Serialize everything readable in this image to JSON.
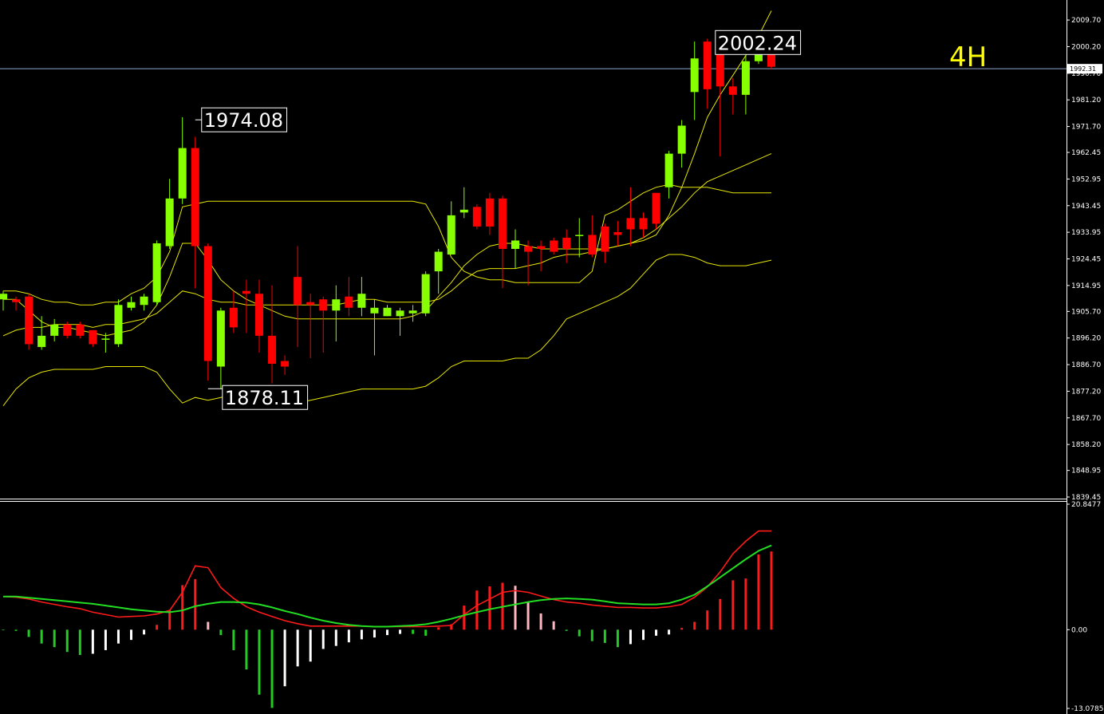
{
  "timeframe_label": "4H",
  "current_price_label": "1992.31",
  "colors": {
    "background": "#000000",
    "bull": "#88ff00",
    "bear": "#ff0000",
    "band": "#e6e600",
    "macd_fast": "#ff1a1a",
    "macd_slow": "#22dd22",
    "hist_up_strong": "#ff1a1a",
    "hist_up_weak": "#ffb6c1",
    "hist_down_strong": "#22cc22",
    "hist_down_weak": "#ffffff",
    "current_line": "#8ea8c8",
    "axis": "#ffffff"
  },
  "chart_data": [
    {
      "type": "candlestick",
      "title": "",
      "ylim": [
        1839.45,
        2014.0
      ],
      "y_ticks": [
        "2009.70",
        "2000.20",
        "1990.70",
        "1981.20",
        "1971.70",
        "1962.45",
        "1952.95",
        "1943.45",
        "1933.95",
        "1924.45",
        "1914.95",
        "1905.70",
        "1896.20",
        "1886.70",
        "1877.20",
        "1867.70",
        "1858.20",
        "1848.95",
        "1839.45"
      ],
      "current_price": 1992.31,
      "annotations": [
        {
          "label": "1974.08",
          "bar": 15,
          "value": 1974.08
        },
        {
          "label": "1878.11",
          "bar": 16,
          "value": 1878.11
        },
        {
          "label": "2002.24",
          "bar": 56,
          "value": 2002.24
        }
      ],
      "candles": [
        [
          1910,
          1912,
          1906,
          1913
        ],
        [
          1910,
          1909,
          1906,
          1911
        ],
        [
          1911,
          1894,
          1892,
          1912
        ],
        [
          1893,
          1897,
          1892,
          1904
        ],
        [
          1897,
          1901,
          1895,
          1903
        ],
        [
          1901,
          1897,
          1896,
          1902
        ],
        [
          1901,
          1897,
          1896,
          1902
        ],
        [
          1899,
          1894,
          1893,
          1899
        ],
        [
          1896,
          1896,
          1891,
          1898
        ],
        [
          1894,
          1908,
          1893,
          1910
        ],
        [
          1907,
          1909,
          1906,
          1911
        ],
        [
          1908,
          1911,
          1906,
          1912
        ],
        [
          1909,
          1930,
          1908,
          1931
        ],
        [
          1929,
          1946,
          1928,
          1953
        ],
        [
          1946,
          1964,
          1944,
          1975
        ],
        [
          1964,
          1929,
          1914,
          1968
        ],
        [
          1929,
          1888,
          1881,
          1930
        ],
        [
          1886,
          1906,
          1878,
          1907
        ],
        [
          1907,
          1900,
          1898,
          1913
        ],
        [
          1913,
          1912,
          1898,
          1917
        ],
        [
          1912,
          1897,
          1891,
          1917
        ],
        [
          1897,
          1887,
          1880,
          1915
        ],
        [
          1888,
          1886,
          1883,
          1890
        ],
        [
          1918,
          1908,
          1893,
          1929
        ],
        [
          1909,
          1908,
          1889,
          1912
        ],
        [
          1910,
          1906,
          1891,
          1911
        ],
        [
          1906,
          1910,
          1895,
          1915
        ],
        [
          1911,
          1907,
          1904,
          1918
        ],
        [
          1907,
          1912,
          1904,
          1918
        ],
        [
          1905,
          1907,
          1890,
          1910
        ],
        [
          1904,
          1907,
          1904,
          1908
        ],
        [
          1904,
          1906,
          1897,
          1907
        ],
        [
          1905,
          1906,
          1902,
          1908
        ],
        [
          1905,
          1919,
          1904,
          1920
        ],
        [
          1920,
          1927,
          1912,
          1928
        ],
        [
          1926,
          1940,
          1926,
          1945
        ],
        [
          1941,
          1942,
          1939,
          1950
        ],
        [
          1943,
          1936,
          1935,
          1944
        ],
        [
          1946,
          1936,
          1933,
          1948
        ],
        [
          1946,
          1928,
          1914,
          1947
        ],
        [
          1928,
          1931,
          1921,
          1935
        ],
        [
          1929,
          1927,
          1915,
          1931
        ],
        [
          1929,
          1928,
          1920,
          1931
        ],
        [
          1931,
          1927,
          1926,
          1932
        ],
        [
          1932,
          1928,
          1923,
          1935
        ],
        [
          1933,
          1933,
          1925,
          1939
        ],
        [
          1933,
          1926,
          1925,
          1940
        ],
        [
          1936,
          1927,
          1923,
          1937
        ],
        [
          1934,
          1933,
          1929,
          1938
        ],
        [
          1939,
          1935,
          1929,
          1950
        ],
        [
          1939,
          1935,
          1932,
          1941
        ],
        [
          1948,
          1937,
          1935,
          1948
        ],
        [
          1950,
          1962,
          1946,
          1963
        ],
        [
          1962,
          1972,
          1957,
          1974
        ],
        [
          1984,
          1996,
          1974,
          2002
        ],
        [
          2002,
          1985,
          1978,
          2003
        ],
        [
          2002,
          1986,
          1961,
          2002
        ],
        [
          1986,
          1983,
          1976,
          1989
        ],
        [
          1983,
          1995,
          1976,
          1998
        ],
        [
          1995,
          1999,
          1994,
          2000
        ],
        [
          1999,
          1993,
          1992,
          2000
        ]
      ],
      "bollinger": {
        "upper": [
          1913,
          1913,
          1912,
          1910,
          1909,
          1909,
          1908,
          1908,
          1909,
          1909,
          1912,
          1914,
          1918,
          1927,
          1943,
          1944,
          1945,
          1945,
          1945,
          1945,
          1945,
          1945,
          1945,
          1945,
          1945,
          1945,
          1945,
          1945,
          1945,
          1945,
          1945,
          1945,
          1945,
          1944,
          1936,
          1925,
          1920,
          1918,
          1917,
          1917,
          1916,
          1916,
          1916,
          1916,
          1916,
          1916,
          1920,
          1940,
          1942,
          1945,
          1948,
          1950,
          1951,
          1950,
          1950,
          1950,
          1949,
          1948,
          1948,
          1948,
          1948
        ],
        "middle": [
          1897,
          1899,
          1900,
          1900,
          1901,
          1901,
          1901,
          1900,
          1901,
          1901,
          1902,
          1903,
          1905,
          1909,
          1913,
          1912,
          1910,
          1909,
          1909,
          1908,
          1908,
          1908,
          1908,
          1908,
          1908,
          1908,
          1908,
          1909,
          1910,
          1910,
          1909,
          1909,
          1909,
          1909,
          1910,
          1913,
          1917,
          1920,
          1921,
          1921,
          1921,
          1922,
          1923,
          1925,
          1926,
          1926,
          1927,
          1928,
          1929,
          1930,
          1932,
          1935,
          1939,
          1943,
          1948,
          1952,
          1954,
          1956,
          1958,
          1960,
          1962
        ],
        "lower": [
          1872,
          1878,
          1882,
          1884,
          1885,
          1885,
          1885,
          1885,
          1886,
          1886,
          1886,
          1886,
          1884,
          1878,
          1873,
          1875,
          1874,
          1875,
          1876,
          1876,
          1875,
          1874,
          1873,
          1873,
          1874,
          1875,
          1876,
          1877,
          1878,
          1878,
          1878,
          1878,
          1878,
          1879,
          1882,
          1886,
          1888,
          1888,
          1888,
          1888,
          1889,
          1889,
          1892,
          1897,
          1903,
          1905,
          1907,
          1909,
          1911,
          1914,
          1919,
          1924,
          1926,
          1926,
          1925,
          1923,
          1922,
          1922,
          1922,
          1923,
          1924
        ]
      },
      "line": [
        1910,
        1910,
        1906,
        1902,
        1900,
        1900,
        1899,
        1898,
        1897,
        1898,
        1899,
        1902,
        1908,
        1918,
        1930,
        1930,
        1924,
        1917,
        1913,
        1910,
        1908,
        1906,
        1904,
        1903,
        1903,
        1903,
        1903,
        1903,
        1903,
        1903,
        1903,
        1903,
        1904,
        1906,
        1911,
        1916,
        1922,
        1926,
        1929,
        1930,
        1930,
        1929,
        1928,
        1928,
        1928,
        1928,
        1928,
        1928,
        1929,
        1930,
        1931,
        1933,
        1940,
        1950,
        1962,
        1975,
        1983,
        1990,
        1997,
        2004,
        2013
      ]
    },
    {
      "type": "macd",
      "ylim": [
        -13.0785,
        20.8477
      ],
      "y_ticks": [
        "20.8477",
        "0.00",
        "-13.0785"
      ],
      "fast_line": [
        5.5,
        5.4,
        5.1,
        4.6,
        4.2,
        3.8,
        3.5,
        2.9,
        2.5,
        2.1,
        2.2,
        2.3,
        2.6,
        3.2,
        6.2,
        10.6,
        10.3,
        7.0,
        5.2,
        3.8,
        2.9,
        2.2,
        1.5,
        1.0,
        0.6,
        0.6,
        0.6,
        0.6,
        0.6,
        0.5,
        0.5,
        0.5,
        0.5,
        0.5,
        0.6,
        0.7,
        2.5,
        4.0,
        5.1,
        6.2,
        6.5,
        6.2,
        5.6,
        5.0,
        4.6,
        4.4,
        4.1,
        3.9,
        3.7,
        3.7,
        3.6,
        3.6,
        3.8,
        4.2,
        5.4,
        7.1,
        9.6,
        12.6,
        14.7,
        16.4,
        16.4
      ],
      "slow_line": [
        5.5,
        5.5,
        5.3,
        5.1,
        4.9,
        4.7,
        4.5,
        4.3,
        4.0,
        3.7,
        3.4,
        3.2,
        3.0,
        2.9,
        3.2,
        3.9,
        4.3,
        4.6,
        4.6,
        4.5,
        4.2,
        3.7,
        3.1,
        2.6,
        2.0,
        1.5,
        1.1,
        0.8,
        0.6,
        0.5,
        0.5,
        0.6,
        0.7,
        0.9,
        1.3,
        1.8,
        2.4,
        2.9,
        3.4,
        3.8,
        4.2,
        4.6,
        4.9,
        5.1,
        5.2,
        5.1,
        5.0,
        4.7,
        4.4,
        4.3,
        4.2,
        4.2,
        4.4,
        5.0,
        5.8,
        7.2,
        8.7,
        10.2,
        11.7,
        13.1,
        14.0
      ],
      "histogram": [
        -0.1,
        -0.2,
        -1.2,
        -2.3,
        -2.9,
        -3.7,
        -4.2,
        -4.0,
        -3.4,
        -2.3,
        -1.7,
        -0.8,
        0.8,
        3.3,
        7.4,
        8.4,
        1.3,
        -0.9,
        -3.4,
        -6.6,
        -10.8,
        -13.0,
        -9.4,
        -6.1,
        -5.3,
        -3.2,
        -2.7,
        -2.1,
        -1.6,
        -1.3,
        -0.9,
        -0.7,
        -0.7,
        -1.0,
        0.4,
        0.9,
        4.0,
        6.5,
        7.2,
        7.8,
        7.3,
        4.7,
        2.7,
        1.4,
        -0.2,
        -1.1,
        -1.9,
        -2.2,
        -2.9,
        -2.4,
        -1.7,
        -1.0,
        -0.8,
        0.3,
        1.3,
        3.2,
        5.1,
        8.2,
        8.5,
        12.5,
        13.0
      ]
    }
  ]
}
